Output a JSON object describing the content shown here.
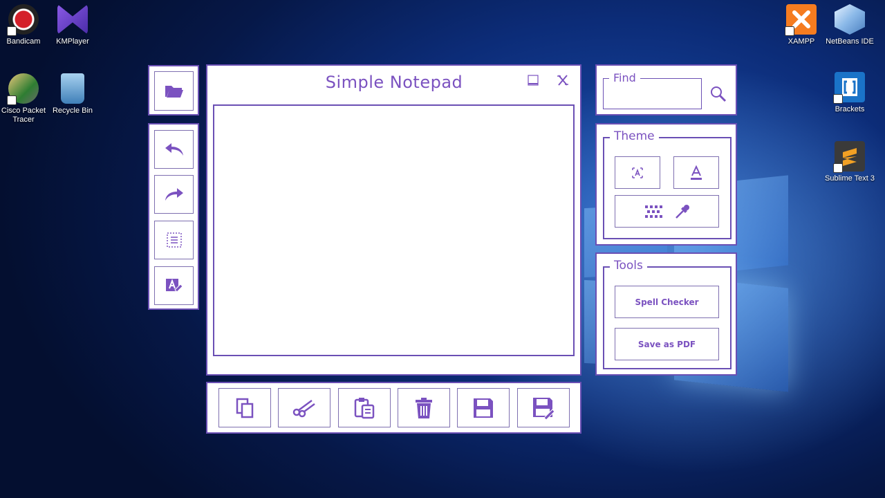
{
  "desktop": {
    "icons_left": [
      {
        "label": "Bandicam",
        "icon": "bandicam-icon",
        "color": "#d4202a"
      },
      {
        "label": "KMPlayer",
        "icon": "kmplayer-icon",
        "color": "#6b3fd0"
      },
      {
        "label": "Cisco Packet Tracer",
        "icon": "cisco-packet-tracer-icon",
        "color": "#2e7d32"
      },
      {
        "label": "Recycle Bin",
        "icon": "recycle-bin-icon",
        "color": "#5aa0d8"
      }
    ],
    "icons_right": [
      {
        "label": "XAMPP",
        "icon": "xampp-icon",
        "color": "#f57c20"
      },
      {
        "label": "NetBeans IDE",
        "icon": "netbeans-icon",
        "color": "#8ab8e8"
      },
      {
        "label": "Brackets",
        "icon": "brackets-icon",
        "color": "#1a73c8"
      },
      {
        "label": "Sublime Text 3",
        "icon": "sublime-text-icon",
        "color": "#f2a024"
      }
    ]
  },
  "app": {
    "title": "Simple Notepad",
    "accent": "#7b52c0",
    "border": "#6a4fb4",
    "editor_text": "",
    "left_toolbar": [
      "open-folder-icon",
      "undo-icon",
      "redo-icon",
      "select-all-icon",
      "font-edit-icon"
    ],
    "bottom_toolbar": [
      "copy-icon",
      "cut-icon",
      "paste-icon",
      "delete-icon",
      "save-icon",
      "save-as-icon"
    ],
    "find": {
      "label": "Find",
      "value": ""
    },
    "theme": {
      "label": "Theme"
    },
    "tools": {
      "label": "Tools",
      "spell_checker": "Spell Checker",
      "save_pdf": "Save as PDF"
    }
  }
}
